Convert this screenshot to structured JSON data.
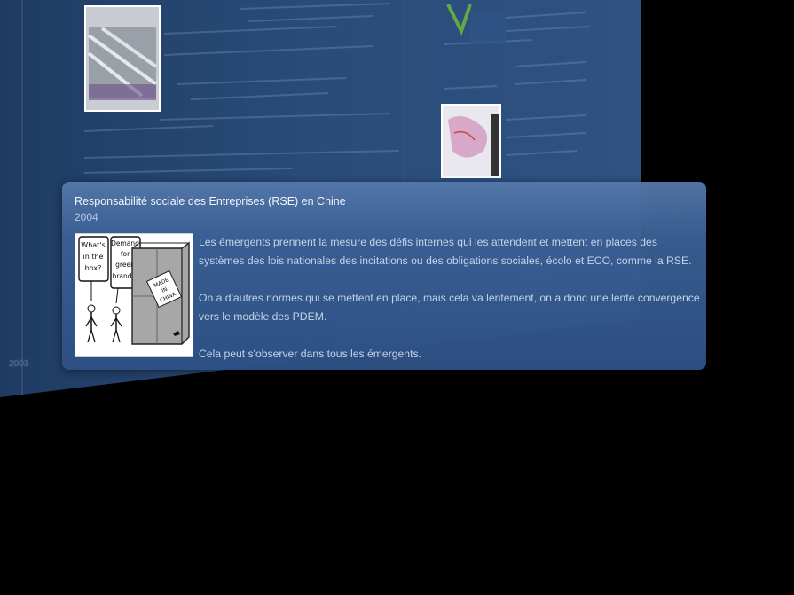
{
  "card": {
    "title": "Responsabilité sociale des Entreprises (RSE) en Chine",
    "year": "2004",
    "paragraphs": [
      "Les émergents prennent la mesure des défis internes qui les attendent et mettent en places des systèmes des lois nationales des incitations ou des obligations sociales, écolo et ECO, comme la RSE.",
      "On a d'autres normes qui se mettent en place, mais cela va lentement, on a donc une lente convergence vers le modèle des PDEM.",
      "Cela peut s'observer dans tous les émergents."
    ],
    "cartoon": {
      "bubble_left": [
        "What's",
        "in the",
        "box?"
      ],
      "bubble_right": [
        "Demand",
        "for",
        "green",
        "brands!"
      ],
      "crate_label": [
        "MADE",
        "IN",
        "CHINA"
      ]
    }
  },
  "background": {
    "year_tick": "2003",
    "blurred_lines": [
      "ENCORE, CIVIS récolte de ...",
      "→ pas seulement à Chine Afrique ...",
      "→ Chine, ...",
      "Danger ...",
      "Une aubaine ...",
      "Où ...",
      "par les ..."
    ]
  },
  "colors": {
    "page_bg": "#000000",
    "panel_bg": "#27456f",
    "card_top": "#5478aa",
    "card_bottom": "#2d5084",
    "title_text": "#f2f5fa",
    "body_text": "#c4d2e6"
  }
}
